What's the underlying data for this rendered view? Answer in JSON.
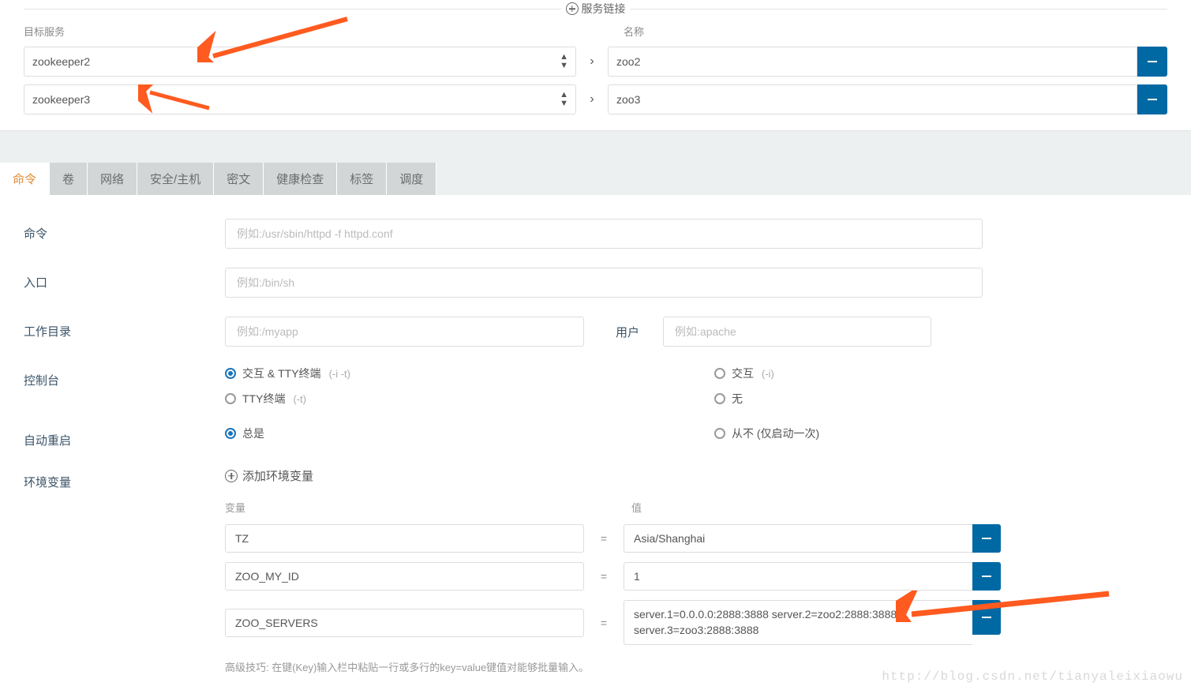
{
  "serviceLink": {
    "sectionTitle": "服务链接",
    "labels": {
      "target": "目标服务",
      "name": "名称"
    },
    "rows": [
      {
        "target": "zookeeper2",
        "name": "zoo2"
      },
      {
        "target": "zookeeper3",
        "name": "zoo3"
      }
    ]
  },
  "tabs": [
    "命令",
    "卷",
    "网络",
    "安全/主机",
    "密文",
    "健康检查",
    "标签",
    "调度"
  ],
  "activeTabIndex": 0,
  "command": {
    "labels": {
      "command": "命令",
      "entry": "入口",
      "workdir": "工作目录",
      "user": "用户",
      "console": "控制台",
      "autoRestart": "自动重启",
      "envVars": "环境变量"
    },
    "placeholders": {
      "command": "例如:/usr/sbin/httpd -f httpd.conf",
      "entry": "例如:/bin/sh",
      "workdir": "例如:/myapp",
      "user": "例如:apache"
    },
    "console": {
      "opt1": {
        "text": "交互 & TTY终端",
        "hint": "(-i -t)"
      },
      "opt2": {
        "text": "交互",
        "hint": "(-i)"
      },
      "opt3": {
        "text": "TTY终端",
        "hint": "(-t)"
      },
      "opt4": {
        "text": "无",
        "hint": ""
      }
    },
    "restart": {
      "opt1": {
        "text": "总是"
      },
      "opt2": {
        "text": "从不  (仅启动一次)"
      }
    },
    "env": {
      "addLabel": "添加环境变量",
      "headers": {
        "var": "变量",
        "val": "值"
      },
      "rows": [
        {
          "key": "TZ",
          "val": "Asia/Shanghai"
        },
        {
          "key": "ZOO_MY_ID",
          "val": "1"
        },
        {
          "key": "ZOO_SERVERS",
          "val": "server.1=0.0.0.0:2888:3888 server.2=zoo2:2888:3888 server.3=zoo3:2888:3888"
        }
      ],
      "tip": "高级技巧: 在键(Key)输入栏中粘贴一行或多行的key=value键值对能够批量输入。"
    }
  },
  "watermark": "http://blog.csdn.net/tianyaleixiaowu"
}
